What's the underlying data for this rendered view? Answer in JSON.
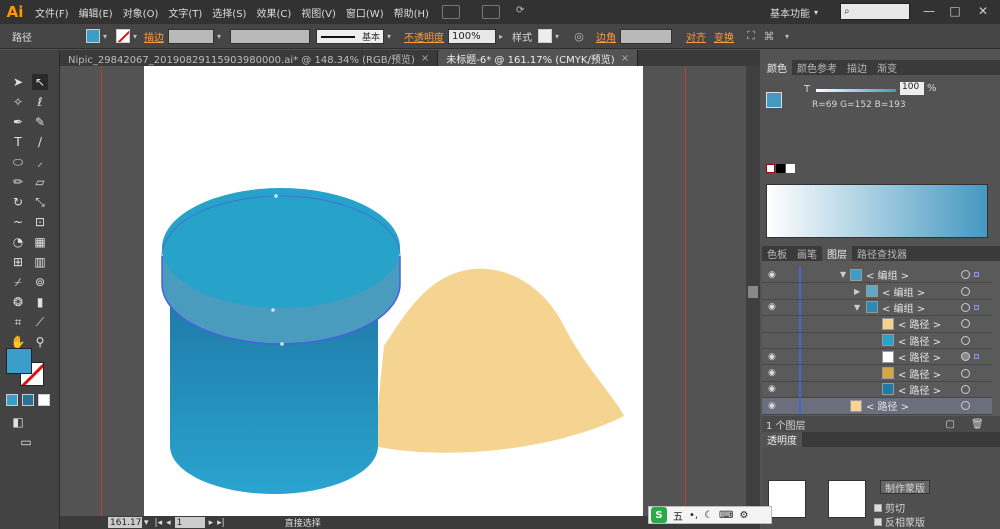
{
  "app": {
    "logo": "Ai",
    "workspace": "基本功能",
    "search_icon": "search-icon"
  },
  "menu": [
    "文件(F)",
    "编辑(E)",
    "对象(O)",
    "文字(T)",
    "选择(S)",
    "效果(C)",
    "视图(V)",
    "窗口(W)",
    "帮助(H)"
  ],
  "control": {
    "selection_label": "路径",
    "fill_color": "#3a9ec9",
    "stroke_label": "描边",
    "stroke_style": "基本",
    "opacity_label": "不透明度",
    "opacity_value": "100%",
    "style_label": "样式",
    "corner_label": "边角",
    "align_label": "对齐",
    "transform_label": "变换"
  },
  "tabs": [
    {
      "label": "Nipic_29842067_20190829115903980000.ai* @ 148.34% (RGB/预览)",
      "close": "×"
    },
    {
      "label": "未标题-6* @ 161.17% (CMYK/预览)",
      "close": "×"
    }
  ],
  "status": {
    "zoom": "161.17",
    "page": "1",
    "tool": "直接选择"
  },
  "color_panel": {
    "tabs": [
      "颜色",
      "颜色参考",
      "描边",
      "渐变"
    ],
    "tint_label": "T",
    "tint_value": "100",
    "rgb_readout": "R=69  G=152  B=193",
    "fill": "#4598c1"
  },
  "layers_panel": {
    "tabs": [
      "色板",
      "画笔",
      "图层",
      "路径查找器"
    ],
    "rows": [
      {
        "label": "< 编组 >"
      },
      {
        "label": "< 编组 >"
      },
      {
        "label": "< 编组 >"
      },
      {
        "label": "< 路径 >"
      },
      {
        "label": "< 路径 >"
      },
      {
        "label": "< 路径 >"
      },
      {
        "label": "< 路径 >"
      },
      {
        "label": "< 路径 >"
      },
      {
        "label": "< 路径 >"
      }
    ],
    "footer": "1 个图层"
  },
  "transparency_panel": {
    "tab": "透明度",
    "make_mask": "制作蒙版",
    "clip": "剪切",
    "invert": "反相蒙版"
  },
  "ime": {
    "label": "五"
  },
  "colors": {
    "cylinder_top": "#27a2c8",
    "cylinder_side": "#2484b0",
    "shadow": "#f5d390",
    "selection": "#4a5fe0"
  }
}
